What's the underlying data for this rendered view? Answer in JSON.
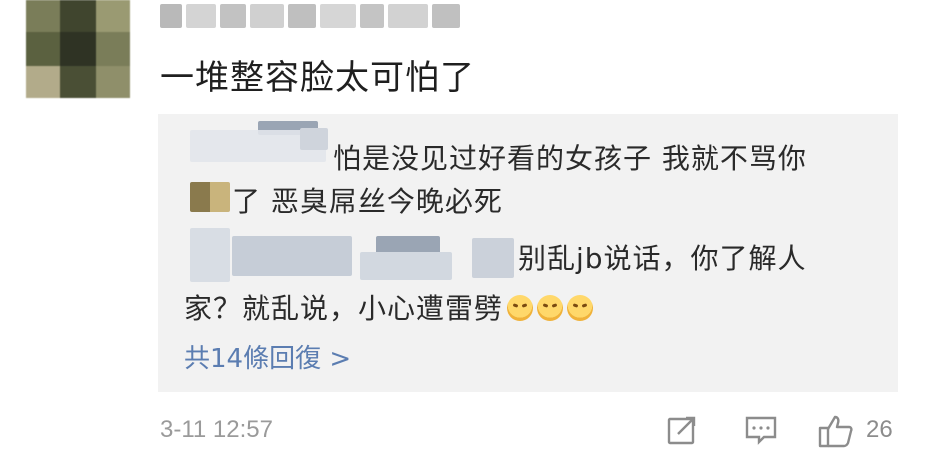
{
  "comment": {
    "text": "一堆整容脸太可怕了",
    "time": "3-11 12:57",
    "likes": "26"
  },
  "replies": {
    "line1": "怕是没见过好看的女孩子 我就不骂你",
    "line2": "了 恶臭屌丝今晚必死",
    "line3": "别乱jb说话，你了解人",
    "line4": "家？就乱说，小心遭雷劈",
    "more": "共14條回復 >"
  },
  "icons": {
    "avatar": "blurred-user-avatar",
    "share": "share-icon",
    "comment": "comment-icon",
    "like": "thumbs-up-icon",
    "emoji": "angry-face-emoji"
  }
}
